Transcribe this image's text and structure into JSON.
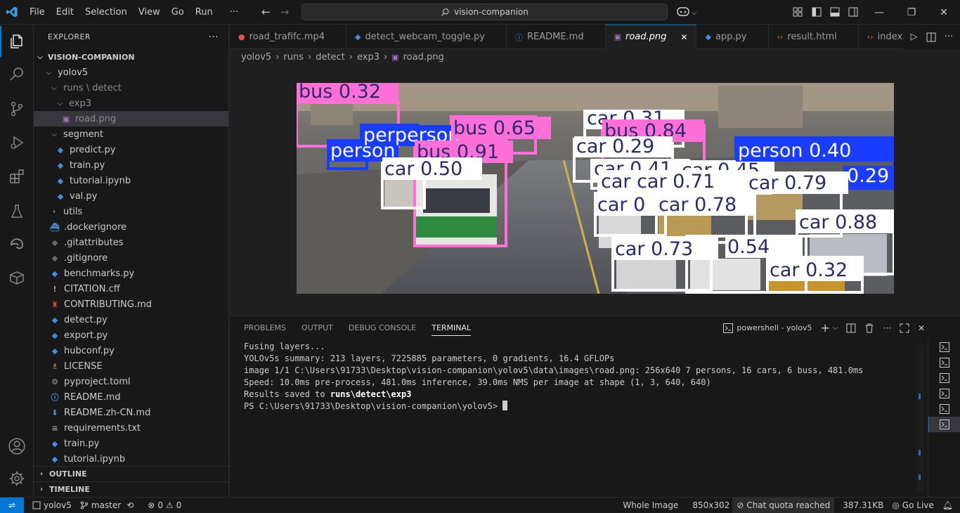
{
  "menu": [
    "File",
    "Edit",
    "Selection",
    "View",
    "Go",
    "Run",
    "···"
  ],
  "search": {
    "text": "vision-companion"
  },
  "sidebar": {
    "header": "EXPLORER",
    "more": "···",
    "root": "VISION-COMPANION",
    "items": [
      {
        "label": "yolov5",
        "depth": 1,
        "type": "folder-open"
      },
      {
        "label": "runs \\ detect",
        "depth": 2,
        "type": "folder-open",
        "dim": true
      },
      {
        "label": "exp3",
        "depth": 3,
        "type": "folder-open",
        "dim": true
      },
      {
        "label": "road.png",
        "depth": 4,
        "type": "image",
        "dim": true,
        "selected": true
      },
      {
        "label": "segment",
        "depth": 2,
        "type": "folder-open"
      },
      {
        "label": "predict.py",
        "depth": 3,
        "type": "py"
      },
      {
        "label": "train.py",
        "depth": 3,
        "type": "py"
      },
      {
        "label": "tutorial.ipynb",
        "depth": 3,
        "type": "py"
      },
      {
        "label": "val.py",
        "depth": 3,
        "type": "py"
      },
      {
        "label": "utils",
        "depth": 2,
        "type": "folder-closed"
      },
      {
        "label": ".dockerignore",
        "depth": 2,
        "type": "docker"
      },
      {
        "label": ".gitattributes",
        "depth": 2,
        "type": "git"
      },
      {
        "label": ".gitignore",
        "depth": 2,
        "type": "git"
      },
      {
        "label": "benchmarks.py",
        "depth": 2,
        "type": "py"
      },
      {
        "label": "CITATION.cff",
        "depth": 2,
        "type": "cff"
      },
      {
        "label": "CONTRIBUTING.md",
        "depth": 2,
        "type": "contrib"
      },
      {
        "label": "detect.py",
        "depth": 2,
        "type": "py"
      },
      {
        "label": "export.py",
        "depth": 2,
        "type": "py"
      },
      {
        "label": "hubconf.py",
        "depth": 2,
        "type": "py"
      },
      {
        "label": "LICENSE",
        "depth": 2,
        "type": "license"
      },
      {
        "label": "pyproject.toml",
        "depth": 2,
        "type": "gear"
      },
      {
        "label": "README.md",
        "depth": 2,
        "type": "info"
      },
      {
        "label": "README.zh-CN.md",
        "depth": 2,
        "type": "down"
      },
      {
        "label": "requirements.txt",
        "depth": 2,
        "type": "txt"
      },
      {
        "label": "train.py",
        "depth": 2,
        "type": "py"
      },
      {
        "label": "tutorial.ipynb",
        "depth": 2,
        "type": "py"
      }
    ],
    "outline": "OUTLINE",
    "timeline": "TIMELINE"
  },
  "tabs": [
    {
      "label": "road_trafifc.mp4",
      "icon": "video"
    },
    {
      "label": "detect_webcam_toggle.py",
      "icon": "py"
    },
    {
      "label": "README.md",
      "icon": "info"
    },
    {
      "label": "road.png",
      "icon": "image",
      "active": true
    },
    {
      "label": "app.py",
      "icon": "py"
    },
    {
      "label": "result.html",
      "icon": "html"
    },
    {
      "label": "index.html",
      "icon": "html"
    }
  ],
  "breadcrumb": [
    "yolov5",
    "runs",
    "detect",
    "exp3",
    "road.png"
  ],
  "detections": [
    {
      "label": "bus 0.32",
      "color": "#ff6fd8"
    },
    {
      "label": "person",
      "color": "#1a3cff"
    },
    {
      "label": "perperson",
      "color": "#1a3cff"
    },
    {
      "label": "bus 0.65",
      "color": "#ff6fd8"
    },
    {
      "label": "bus 0.91",
      "color": "#ff6fd8"
    },
    {
      "label": "car 0.31",
      "color": "#ffffff"
    },
    {
      "label": "bus 0.84",
      "color": "#ff6fd8"
    },
    {
      "label": "car 0.50",
      "color": "#ffffff"
    },
    {
      "label": "car 0.29",
      "color": "#ffffff"
    },
    {
      "label": "car 0.41",
      "color": "#ffffff"
    },
    {
      "label": "car 0.45",
      "color": "#ffffff"
    },
    {
      "label": "car car 0.71",
      "color": "#ffffff"
    },
    {
      "label": "person 0.40",
      "color": "#1a3cff"
    },
    {
      "label": "0.29",
      "color": "#1a3cff"
    },
    {
      "label": "car 0.79",
      "color": "#ffffff"
    },
    {
      "label": "car 0",
      "color": "#ffffff"
    },
    {
      "label": "car 0.78",
      "color": "#ffffff"
    },
    {
      "label": "car 0.88",
      "color": "#ffffff"
    },
    {
      "label": "car 0.73",
      "color": "#ffffff"
    },
    {
      "label": "0.54",
      "color": "#ffffff"
    },
    {
      "label": "car 0.32",
      "color": "#ffffff"
    }
  ],
  "panel": {
    "tabs": [
      "PROBLEMS",
      "OUTPUT",
      "DEBUG CONSOLE",
      "TERMINAL"
    ],
    "shell": "powershell - yolov5",
    "lines": [
      "Fusing layers...",
      "YOLOv5s summary: 213 layers, 7225885 parameters, 0 gradients, 16.4 GFLOPs",
      "image 1/1 C:\\Users\\91733\\Desktop\\vision-companion\\yolov5\\data\\images\\road.png: 256x640 7 persons, 16 cars, 6 buss, 481.0ms",
      "Speed: 10.0ms pre-process, 481.0ms inference, 39.0ms NMS per image at shape (1, 3, 640, 640)"
    ],
    "saved_prefix": "Results saved to ",
    "saved_path": "runs\\detect\\exp3",
    "prompt": "PS C:\\Users\\91733\\Desktop\\vision-companion\\yolov5> "
  },
  "status": {
    "branch_repo": "yolov5",
    "branch": "master",
    "errors": "0",
    "warnings": "0",
    "view": "Whole Image",
    "size": "850x302",
    "chat": "Chat quota reached",
    "filesize": "387.31KB",
    "golive": "Go Live"
  }
}
